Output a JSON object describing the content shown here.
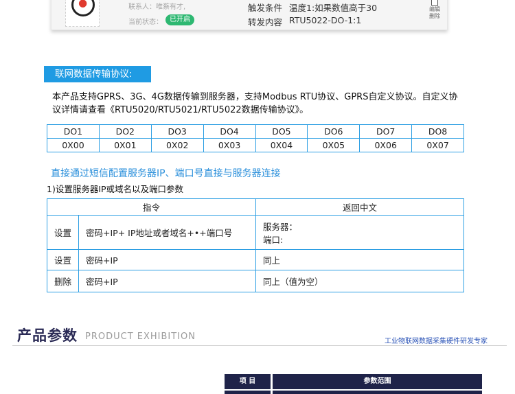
{
  "card": {
    "contact": "联系人：唯蔡有才,",
    "status_label": "当前状态：",
    "status_badge": "已开启",
    "trigger_key": "触发条件",
    "trigger_val": "温度1:如果数值高于30",
    "forward_key": "转发内容",
    "forward_val": "RTU5022-DO-1:1",
    "edit_label": "编辑",
    "delete_label": "删除",
    "logo_icon": "map-pin-icon"
  },
  "section": {
    "title": "联网数据传输协议:",
    "intro": "本产品支持GPRS、3G、4G数据传输到服务器，支持Modbus RTU协议、GPRS自定义协议。自定义协议详情请查看《RTU5020/RTU5021/RTU5022数据传输协议》。"
  },
  "do_table": {
    "headers": [
      "DO1",
      "DO2",
      "DO3",
      "DO4",
      "DO5",
      "DO6",
      "DO7",
      "DO8"
    ],
    "codes": [
      "0X00",
      "0X01",
      "0X02",
      "0X03",
      "0X04",
      "0X05",
      "0X06",
      "0X07"
    ]
  },
  "sms": {
    "title": "直接通过短信配置服务器IP、端口号直接与服务器连接",
    "subtitle": "1)设置服务器IP或域名以及端口参数"
  },
  "cmd_table": {
    "head_cmd": "指令",
    "head_reply": "返回中文",
    "rows": [
      {
        "type": "设置",
        "cmd": "密码+IP+ IP地址或者域名+•+端口号",
        "reply_line1": "服务器：",
        "reply_line2": "端口:"
      },
      {
        "type": "设置",
        "cmd": "密码+IP",
        "reply_line1": "同上",
        "reply_line2": ""
      },
      {
        "type": "删除",
        "cmd": "密码+IP",
        "reply_line1": "同上（值为空）",
        "reply_line2": ""
      }
    ]
  },
  "product": {
    "title": "产品参数",
    "title_en": "PRODUCT  EXHIBITION",
    "tagline": "工业物联网数据采集硬件研发专家",
    "col_item": "项  目",
    "col_range": "参数范围"
  },
  "colors": {
    "accent_blue": "#1f9be3",
    "status_green": "#2eb872",
    "navy": "#1f2349"
  }
}
